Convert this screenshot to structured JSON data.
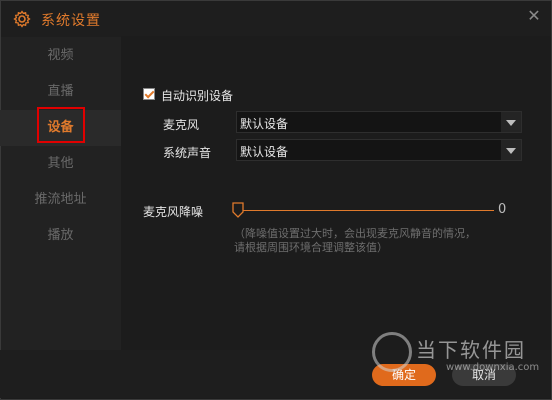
{
  "window": {
    "title": "系统设置",
    "title_icon": "gear-icon",
    "close_icon": "close-icon"
  },
  "sidebar": {
    "items": [
      {
        "label": "视频"
      },
      {
        "label": "直播"
      },
      {
        "label": "设备"
      },
      {
        "label": "其他"
      },
      {
        "label": "推流地址"
      },
      {
        "label": "播放"
      }
    ],
    "active_index": 2
  },
  "device": {
    "auto_detect": {
      "label": "自动识别设备",
      "checked": true
    },
    "microphone": {
      "label": "麦克风",
      "value": "默认设备"
    },
    "system_sound": {
      "label": "系统声音",
      "value": "默认设备"
    },
    "noise_reduction": {
      "label": "麦克风降噪",
      "value": "0",
      "level": 0,
      "hint_line1": "（降噪值设置过大时，会出现麦克风静音的情况，",
      "hint_line2": "请根据周围环境合理调整该值）"
    }
  },
  "footer": {
    "ok_label": "确定",
    "cancel_label": "取消"
  },
  "watermark": {
    "text": "当下软件园",
    "url": "www.downxia.com"
  },
  "colors": {
    "accent": "#e07a2c",
    "background": "#1c1c1c",
    "sidebar": "#222222",
    "highlight_box": "#e00000",
    "ok_button": "#e06a1c"
  }
}
